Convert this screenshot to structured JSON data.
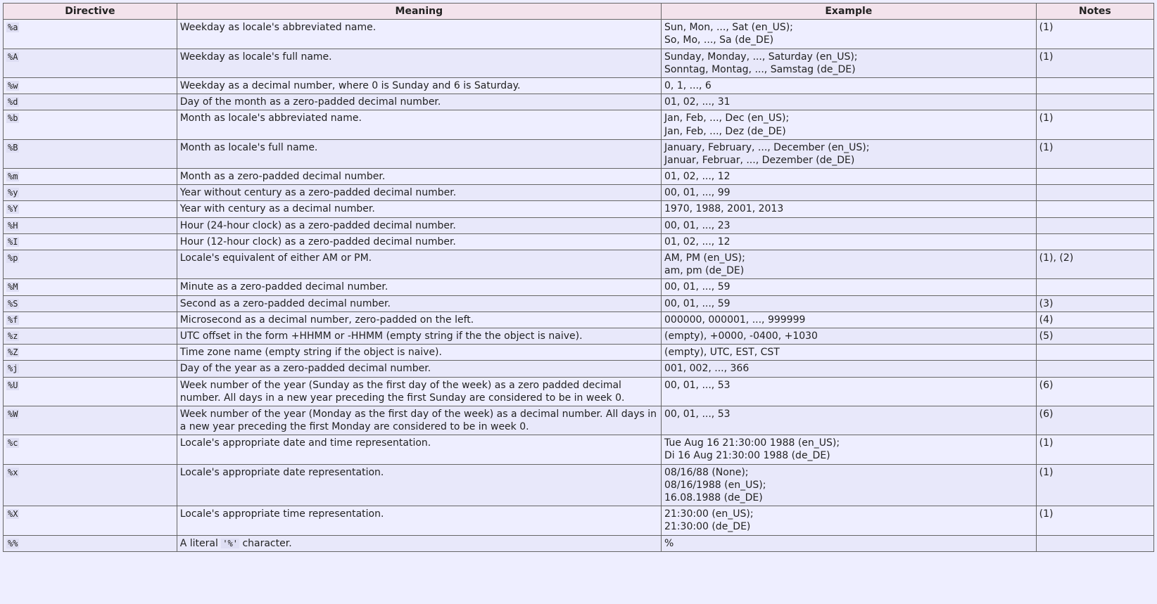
{
  "headers": {
    "directive": "Directive",
    "meaning": "Meaning",
    "example": "Example",
    "notes": "Notes"
  },
  "rows": [
    {
      "directive": "%a",
      "meaning": "Weekday as locale's abbreviated name.",
      "example": "Sun, Mon, ..., Sat (en_US);\nSo, Mo, ..., Sa (de_DE)",
      "notes": "(1)"
    },
    {
      "directive": "%A",
      "meaning": "Weekday as locale's full name.",
      "example": "Sunday, Monday, ..., Saturday (en_US);\nSonntag, Montag, ..., Samstag (de_DE)",
      "notes": "(1)"
    },
    {
      "directive": "%w",
      "meaning": "Weekday as a decimal number, where 0 is Sunday and 6 is Saturday.",
      "example": "0, 1, ..., 6",
      "notes": ""
    },
    {
      "directive": "%d",
      "meaning": "Day of the month as a zero-padded decimal number.",
      "example": "01, 02, ..., 31",
      "notes": ""
    },
    {
      "directive": "%b",
      "meaning": "Month as locale's abbreviated name.",
      "example": "Jan, Feb, ..., Dec (en_US);\nJan, Feb, ..., Dez (de_DE)",
      "notes": "(1)"
    },
    {
      "directive": "%B",
      "meaning": "Month as locale's full name.",
      "example": "January, February, ..., December (en_US);\nJanuar, Februar, ..., Dezember (de_DE)",
      "notes": "(1)"
    },
    {
      "directive": "%m",
      "meaning": "Month as a zero-padded decimal number.",
      "example": "01, 02, ..., 12",
      "notes": ""
    },
    {
      "directive": "%y",
      "meaning": "Year without century as a zero-padded decimal number.",
      "example": "00, 01, ..., 99",
      "notes": ""
    },
    {
      "directive": "%Y",
      "meaning": "Year with century as a decimal number.",
      "example": "1970, 1988, 2001, 2013",
      "notes": ""
    },
    {
      "directive": "%H",
      "meaning": "Hour (24-hour clock) as a zero-padded decimal number.",
      "example": "00, 01, ..., 23",
      "notes": ""
    },
    {
      "directive": "%I",
      "meaning": "Hour (12-hour clock) as a zero-padded decimal number.",
      "example": "01, 02, ..., 12",
      "notes": ""
    },
    {
      "directive": "%p",
      "meaning": "Locale's equivalent of either AM or PM.",
      "example": "AM, PM (en_US);\nam, pm (de_DE)",
      "notes": "(1), (2)"
    },
    {
      "directive": "%M",
      "meaning": "Minute as a zero-padded decimal number.",
      "example": "00, 01, ..., 59",
      "notes": ""
    },
    {
      "directive": "%S",
      "meaning": "Second as a zero-padded decimal number.",
      "example": "00, 01, ..., 59",
      "notes": "(3)"
    },
    {
      "directive": "%f",
      "meaning": "Microsecond as a decimal number, zero-padded on the left.",
      "example": "000000, 000001, ..., 999999",
      "notes": "(4)"
    },
    {
      "directive": "%z",
      "meaning": "UTC offset in the form +HHMM or -HHMM (empty string if the the object is naive).",
      "example": "(empty), +0000, -0400, +1030",
      "notes": "(5)"
    },
    {
      "directive": "%Z",
      "meaning": "Time zone name (empty string if the object is naive).",
      "example": "(empty), UTC, EST, CST",
      "notes": ""
    },
    {
      "directive": "%j",
      "meaning": "Day of the year as a zero-padded decimal number.",
      "example": "001, 002, ..., 366",
      "notes": ""
    },
    {
      "directive": "%U",
      "meaning": "Week number of the year (Sunday as the first day of the week) as a zero padded decimal number. All days in a new year preceding the first Sunday are considered to be in week 0.",
      "example": "00, 01, ..., 53",
      "notes": "(6)"
    },
    {
      "directive": "%W",
      "meaning": "Week number of the year (Monday as the first day of the week) as a decimal number. All days in a new year preceding the first Monday are considered to be in week 0.",
      "example": "00, 01, ..., 53",
      "notes": "(6)"
    },
    {
      "directive": "%c",
      "meaning": "Locale's appropriate date and time representation.",
      "example": "Tue Aug 16 21:30:00 1988 (en_US);\nDi 16 Aug 21:30:00 1988 (de_DE)",
      "notes": "(1)"
    },
    {
      "directive": "%x",
      "meaning": "Locale's appropriate date representation.",
      "example": "08/16/88 (None);\n08/16/1988 (en_US);\n16.08.1988 (de_DE)",
      "notes": "(1)"
    },
    {
      "directive": "%X",
      "meaning": "Locale's appropriate time representation.",
      "example": "21:30:00 (en_US);\n21:30:00 (de_DE)",
      "notes": "(1)"
    },
    {
      "directive": "%%",
      "meaning_pre": "A literal ",
      "meaning_code": "'%'",
      "meaning_post": " character.",
      "example": "%",
      "notes": ""
    }
  ]
}
